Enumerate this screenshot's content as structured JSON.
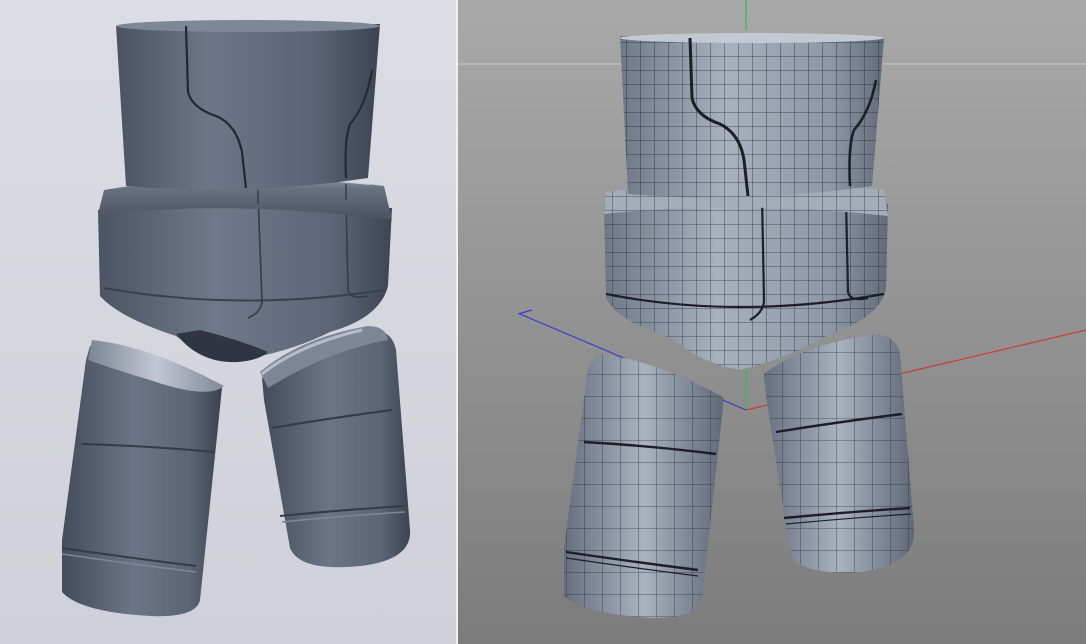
{
  "scene": {
    "left_view": {
      "mode": "shaded-render",
      "background_top": "#dcdce4",
      "background_bottom": "#cfd0d9",
      "material_color": "#5e6878"
    },
    "right_view": {
      "mode": "wireframe-on-shaded",
      "background_top": "#a9a9a9",
      "background_bottom": "#7c7c7c",
      "material_color": "#8c97a6",
      "wire_color": "#1c1f26",
      "axes": {
        "x_color": "#d03a3a",
        "y_color": "#2fbf4a",
        "z_color": "#3a3ad0",
        "horizon_color": "#c9c9c9"
      }
    },
    "divider_color": "#efefef"
  }
}
